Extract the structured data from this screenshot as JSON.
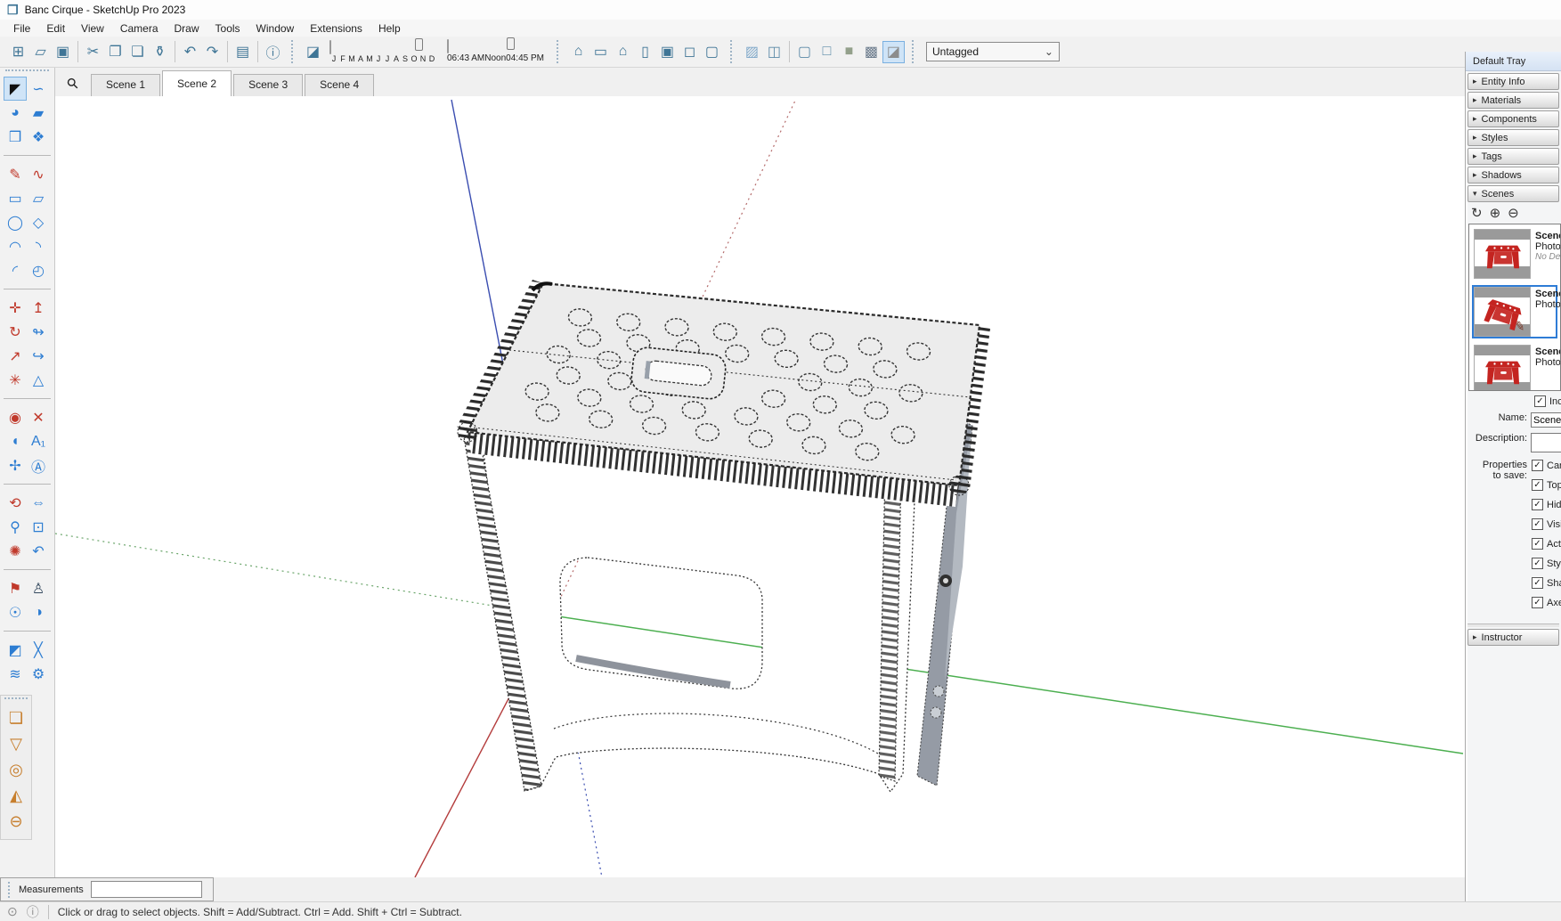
{
  "window": {
    "title": "Banc Cirque - SketchUp Pro 2023",
    "logo_glyph": "❒"
  },
  "menu": {
    "items": [
      {
        "label": "File"
      },
      {
        "label": "Edit"
      },
      {
        "label": "View"
      },
      {
        "label": "Camera"
      },
      {
        "label": "Draw"
      },
      {
        "label": "Tools"
      },
      {
        "label": "Window"
      },
      {
        "label": "Extensions"
      },
      {
        "label": "Help"
      }
    ]
  },
  "toolbar": {
    "file": [
      {
        "name": "new-button",
        "glyph": "⊞"
      },
      {
        "name": "open-button",
        "glyph": "▱"
      },
      {
        "name": "save-button",
        "glyph": "▣"
      },
      {
        "sep": true
      },
      {
        "name": "cut-button",
        "glyph": "✂"
      },
      {
        "name": "copy-button",
        "glyph": "❐"
      },
      {
        "name": "paste-button",
        "glyph": "❏"
      },
      {
        "name": "erase-button",
        "glyph": "⚱"
      },
      {
        "sep": true
      },
      {
        "name": "undo-button",
        "glyph": "↶"
      },
      {
        "name": "redo-button",
        "glyph": "↷"
      },
      {
        "sep": true
      },
      {
        "name": "print-button",
        "glyph": "▤"
      },
      {
        "sep": true
      },
      {
        "name": "model-info-button",
        "glyph": "ⓘ"
      }
    ],
    "shadows": {
      "toggle": {
        "name": "shadows-toggle-button",
        "glyph": "◪"
      },
      "date_labels": [
        "J",
        "F",
        "M",
        "A",
        "M",
        "J",
        "J",
        "A",
        "S",
        "O",
        "N",
        "D"
      ],
      "date_pos_pct": 84,
      "time_labels": [
        "06:43 AM",
        "Noon",
        "04:45 PM"
      ],
      "time_pos_pct": 66
    },
    "views": [
      {
        "name": "view-iso-button",
        "glyph": "⌂",
        "color": "#3f7596"
      },
      {
        "name": "view-top-button",
        "glyph": "▭",
        "color": "#3f7596"
      },
      {
        "name": "view-front-button",
        "glyph": "⌂",
        "color": "#3f7596"
      },
      {
        "name": "view-right-button",
        "glyph": "▯",
        "color": "#3f7596"
      },
      {
        "name": "view-back-button",
        "glyph": "▣",
        "color": "#3f7596"
      },
      {
        "name": "view-left-button",
        "glyph": "◻",
        "color": "#3f7596"
      },
      {
        "name": "view-bottom-button",
        "glyph": "▢",
        "color": "#3f7596"
      }
    ],
    "styles": [
      {
        "name": "style-xray-button",
        "glyph": "▨",
        "color": "#7fa8c9"
      },
      {
        "name": "style-back-edges-button",
        "glyph": "◫",
        "color": "#5c8aa8"
      },
      {
        "sep": true
      },
      {
        "name": "style-wireframe-button",
        "glyph": "▢",
        "color": "#5c8aa8"
      },
      {
        "name": "style-hidden-line-button",
        "glyph": "□",
        "color": "#5c8aa8"
      },
      {
        "name": "style-shaded-button",
        "glyph": "■",
        "color": "#93a08b"
      },
      {
        "name": "style-textured-button",
        "glyph": "▩",
        "color": "#6b7b8c"
      },
      {
        "name": "style-monochrome-button",
        "glyph": "◪",
        "color": "#8c8c8c",
        "active": true
      }
    ],
    "tag_dropdown": {
      "value": "Untagged",
      "chevron": "⌄"
    }
  },
  "scene_tabs": {
    "search_glyph": "⚲",
    "tabs": [
      {
        "label": "Scene 1"
      },
      {
        "label": "Scene 2",
        "active": true
      },
      {
        "label": "Scene 3"
      },
      {
        "label": "Scene 4"
      }
    ]
  },
  "tools": [
    {
      "name": "select-tool",
      "glyph": "◤",
      "color": "#111111",
      "active": true
    },
    {
      "name": "lasso-tool",
      "glyph": "∽",
      "color": "#2d7dd2"
    },
    {
      "name": "paint-bucket-tool",
      "glyph": "◕",
      "color": "#2d7dd2"
    },
    {
      "name": "eraser-tool",
      "glyph": "▰",
      "color": "#2d7dd2"
    },
    {
      "name": "make-component-tool",
      "glyph": "❒",
      "color": "#2d7dd2"
    },
    {
      "name": "tag-tool",
      "glyph": "❖",
      "color": "#2d7dd2"
    },
    {
      "sep": true
    },
    {
      "name": "line-tool",
      "glyph": "✎",
      "color": "#c0392b"
    },
    {
      "name": "freehand-tool",
      "glyph": "∿",
      "color": "#c0392b"
    },
    {
      "name": "rectangle-tool",
      "glyph": "▭",
      "color": "#2d7dd2"
    },
    {
      "name": "rotated-rectangle-tool",
      "glyph": "▱",
      "color": "#2d7dd2"
    },
    {
      "name": "circle-tool",
      "glyph": "◯",
      "color": "#2d7dd2"
    },
    {
      "name": "polygon-tool",
      "glyph": "◇",
      "color": "#2d7dd2"
    },
    {
      "name": "arc-2pt-tool",
      "glyph": "◠",
      "color": "#2d7dd2"
    },
    {
      "name": "arc-3pt-tool",
      "glyph": "◝",
      "color": "#2d7dd2"
    },
    {
      "name": "arc-tool",
      "glyph": "◜",
      "color": "#2d7dd2"
    },
    {
      "name": "pie-tool",
      "glyph": "◴",
      "color": "#2d7dd2"
    },
    {
      "sep": true
    },
    {
      "name": "move-tool",
      "glyph": "✛",
      "color": "#c0392b"
    },
    {
      "name": "push-pull-tool",
      "glyph": "↥",
      "color": "#c0392b"
    },
    {
      "name": "rotate-tool",
      "glyph": "↻",
      "color": "#c0392b"
    },
    {
      "name": "follow-me-tool",
      "glyph": "↬",
      "color": "#2d7dd2"
    },
    {
      "name": "scale-tool",
      "glyph": "↗",
      "color": "#c0392b"
    },
    {
      "name": "offset-tool",
      "glyph": "↪",
      "color": "#2d7dd2"
    },
    {
      "name": "axes-arrows-tool",
      "glyph": "✳",
      "color": "#c0392b"
    },
    {
      "name": "cone-plumb-tool",
      "glyph": "△",
      "color": "#2d7dd2"
    },
    {
      "sep": true
    },
    {
      "name": "tape-measure-tool",
      "glyph": "◉",
      "color": "#c0392b"
    },
    {
      "name": "dimension-tool",
      "glyph": "✕",
      "color": "#c0392b"
    },
    {
      "name": "protractor-tool",
      "glyph": "◖",
      "color": "#2d7dd2"
    },
    {
      "name": "text-tool",
      "glyph": "A₁",
      "color": "#2d7dd2"
    },
    {
      "name": "axes-tool",
      "glyph": "✢",
      "color": "#2d7dd2"
    },
    {
      "name": "3d-text-tool",
      "glyph": "Ⓐ",
      "color": "#2d7dd2"
    },
    {
      "sep": true
    },
    {
      "name": "orbit-tool",
      "glyph": "⟲",
      "color": "#c0392b"
    },
    {
      "name": "pan-tool",
      "glyph": "⇔",
      "color": "#2d7dd2"
    },
    {
      "name": "zoom-tool",
      "glyph": "⚲",
      "color": "#2d7dd2"
    },
    {
      "name": "zoom-window-tool",
      "glyph": "⊡",
      "color": "#2d7dd2"
    },
    {
      "name": "zoom-extents-tool",
      "glyph": "✺",
      "color": "#c0392b"
    },
    {
      "name": "zoom-previous-tool",
      "glyph": "↶",
      "color": "#2d7dd2"
    },
    {
      "sep": true
    },
    {
      "name": "position-camera-tool",
      "glyph": "⚑",
      "color": "#c0392b"
    },
    {
      "name": "walk-tool",
      "glyph": "♙",
      "color": "#34495e"
    },
    {
      "name": "look-around-tool",
      "glyph": "☉",
      "color": "#2d7dd2"
    },
    {
      "name": "look-at-tool",
      "glyph": "◑",
      "color": "#2d7dd2"
    },
    {
      "sep": true
    },
    {
      "name": "section-plane-tool",
      "glyph": "◩",
      "color": "#2d7dd2"
    },
    {
      "name": "display-section-planes-tool",
      "glyph": "╳",
      "color": "#2d7dd2"
    },
    {
      "name": "display-section-cuts-tool",
      "glyph": "≋",
      "color": "#2d7dd2"
    },
    {
      "name": "section-settings-tool",
      "glyph": "⚙",
      "color": "#2d7dd2"
    }
  ],
  "lower_tools": [
    {
      "name": "photo-textures-tool",
      "glyph": "❏",
      "color": "#c77f2e"
    },
    {
      "name": "drape-tool",
      "glyph": "▽",
      "color": "#c77f2e"
    },
    {
      "name": "rings-tool",
      "glyph": "◎",
      "color": "#c77f2e"
    },
    {
      "name": "cone-volume-tool",
      "glyph": "◭",
      "color": "#c77f2e"
    },
    {
      "name": "ellipse-tool",
      "glyph": "⊖",
      "color": "#c77f2e"
    }
  ],
  "tray": {
    "title": "Default Tray",
    "sections": [
      {
        "label": "Entity Info",
        "glyph": "▸"
      },
      {
        "label": "Materials",
        "glyph": "▸"
      },
      {
        "label": "Components",
        "glyph": "▸"
      },
      {
        "label": "Styles",
        "glyph": "▸"
      },
      {
        "label": "Tags",
        "glyph": "▸"
      },
      {
        "label": "Shadows",
        "glyph": "▸"
      }
    ],
    "scenes": {
      "label": "Scenes",
      "glyph": "▾",
      "toolbar": [
        {
          "name": "refresh-scene-button",
          "glyph": "↻"
        },
        {
          "name": "add-scene-button",
          "glyph": "⊕"
        },
        {
          "name": "remove-scene-button",
          "glyph": "⊖"
        }
      ],
      "edit_glyph": "✎",
      "items": [
        {
          "title": "Scene",
          "photo": "Photo:",
          "desc": "No Des"
        },
        {
          "title": "Scene",
          "photo": "Photo:",
          "desc": "",
          "selected": true
        },
        {
          "title": "Scene",
          "photo": "Photo:",
          "desc": ""
        }
      ],
      "include_label": "Inc",
      "name_label": "Name:",
      "name_value": "Scene",
      "description_label": "Description:",
      "description_value": "",
      "props_label_1": "Properties",
      "props_label_2": "to save:",
      "props": [
        {
          "label": "Car"
        },
        {
          "label": "Top"
        },
        {
          "label": "Hid"
        },
        {
          "label": "Visi"
        },
        {
          "label": "Act"
        },
        {
          "label": "Sty"
        },
        {
          "label": "Sha"
        },
        {
          "label": "Axe"
        }
      ]
    },
    "instructor": {
      "label": "Instructor",
      "glyph": "▸"
    }
  },
  "measurements": {
    "label": "Measurements",
    "value": ""
  },
  "statusbar": {
    "icons": [
      {
        "name": "geolocation-icon",
        "glyph": "⊙"
      },
      {
        "name": "credits-icon",
        "glyph": "ⓘ"
      }
    ],
    "hint": "Click or drag to select objects. Shift = Add/Subtract. Ctrl = Add. Shift + Ctrl = Subtract."
  },
  "glyphs": {
    "check": "✓"
  },
  "colors": {
    "accent_blue": "#2e7cd6",
    "toolbar_icon": "#3f7596",
    "tool_red": "#c0392b",
    "tool_blue": "#2d7dd2",
    "orange_tool": "#c77f2e",
    "axis_red": "#b43c3c",
    "axis_green": "#4caf50",
    "axis_blue": "#3a4db0",
    "selection_bg": "#cfe4f7"
  }
}
